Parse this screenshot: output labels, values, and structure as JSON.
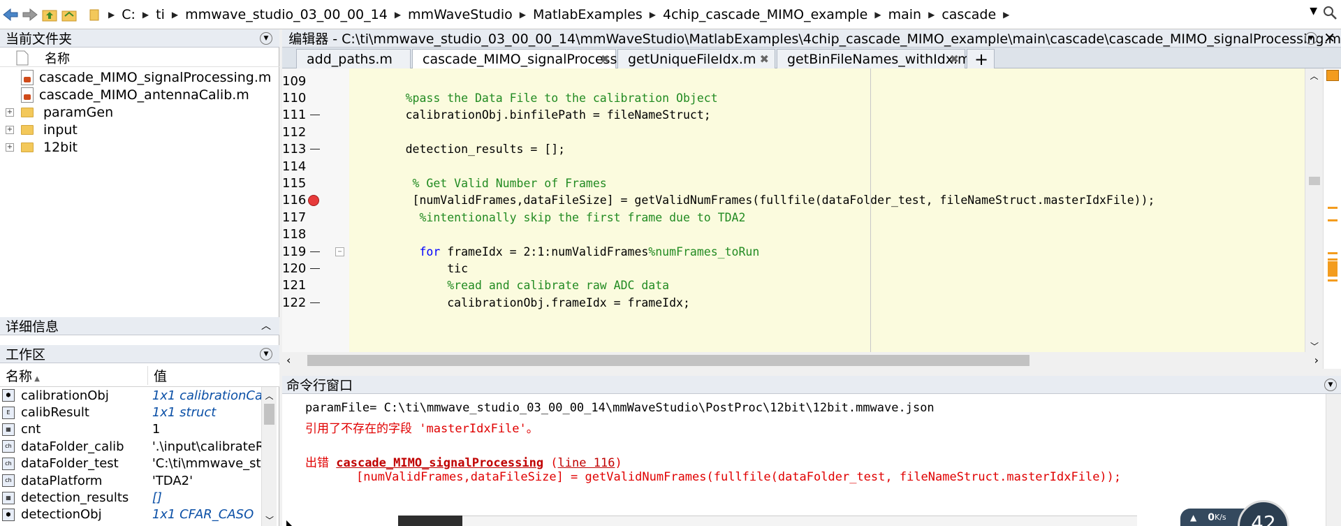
{
  "address_bar": {
    "crumbs": [
      "C:",
      "ti",
      "mmwave_studio_03_00_00_14",
      "mmWaveStudio",
      "MatlabExamples",
      "4chip_cascade_MIMO_example",
      "main",
      "cascade"
    ]
  },
  "current_folder": {
    "title": "当前文件夹",
    "column_name": "名称",
    "items": [
      {
        "name": "cascade_MIMO_signalProcessing.m",
        "type": "mfile"
      },
      {
        "name": "cascade_MIMO_antennaCalib.m",
        "type": "mfile"
      },
      {
        "name": "paramGen",
        "type": "folder"
      },
      {
        "name": "input",
        "type": "folder"
      },
      {
        "name": "12bit",
        "type": "folder"
      }
    ]
  },
  "details": {
    "title": "详细信息"
  },
  "workspace": {
    "title": "工作区",
    "col_name": "名称",
    "col_value": "值",
    "rows": [
      {
        "name": "calibrationObj",
        "value": "1x1 calibrationCa",
        "italic": true,
        "icon": "object-icon"
      },
      {
        "name": "calibResult",
        "value": "1x1 struct",
        "italic": true,
        "icon": "struct-icon"
      },
      {
        "name": "cnt",
        "value": "1",
        "italic": false,
        "icon": "numeric-icon"
      },
      {
        "name": "dataFolder_calib",
        "value": "'.\\input\\calibrateR",
        "italic": false,
        "icon": "char-icon"
      },
      {
        "name": "dataFolder_test",
        "value": "'C:\\ti\\mmwave_stu",
        "italic": false,
        "icon": "char-icon"
      },
      {
        "name": "dataPlatform",
        "value": "'TDA2'",
        "italic": false,
        "icon": "char-icon"
      },
      {
        "name": "detection_results",
        "value": "[]",
        "italic": true,
        "icon": "numeric-icon"
      },
      {
        "name": "detectionObj",
        "value": "1x1 CFAR_CASO",
        "italic": true,
        "icon": "object-icon"
      }
    ]
  },
  "editor": {
    "title": "编辑器 - C:\\ti\\mmwave_studio_03_00_00_14\\mmWaveStudio\\MatlabExamples\\4chip_cascade_MIMO_example\\main\\cascade\\cascade_MIMO_signalProcessing.m",
    "tabs": [
      {
        "label": "add_paths.m",
        "active": false
      },
      {
        "label": "cascade_MIMO_signalProcessing.m",
        "active": true
      },
      {
        "label": "getUniqueFileIdx.m",
        "active": false
      },
      {
        "label": "getBinFileNames_withIdx.m",
        "active": false
      }
    ],
    "add_tab": "+",
    "lines": [
      {
        "n": "109",
        "mark": "",
        "indent": "",
        "parts": []
      },
      {
        "n": "110",
        "mark": "",
        "indent": "      ",
        "parts": [
          {
            "t": "%pass the Data File to the calibration Object",
            "c": "cm"
          }
        ]
      },
      {
        "n": "111",
        "mark": "dash",
        "indent": "      ",
        "parts": [
          {
            "t": "calibrationObj.binfilePath = fileNameStruct;",
            "c": ""
          }
        ]
      },
      {
        "n": "112",
        "mark": "",
        "indent": "",
        "parts": []
      },
      {
        "n": "113",
        "mark": "dash",
        "indent": "      ",
        "parts": [
          {
            "t": "detection_results = [];",
            "c": ""
          }
        ]
      },
      {
        "n": "114",
        "mark": "",
        "indent": "",
        "parts": []
      },
      {
        "n": "115",
        "mark": "",
        "indent": "       ",
        "parts": [
          {
            "t": "% Get Valid Number of Frames",
            "c": "cm"
          }
        ]
      },
      {
        "n": "116",
        "mark": "bp",
        "indent": "       ",
        "parts": [
          {
            "t": "[numValidFrames,dataFileSize] = getValidNumFrames(fullfile(dataFolder_test, fileNameStruct.masterIdxFile));",
            "c": ""
          }
        ]
      },
      {
        "n": "117",
        "mark": "",
        "indent": "        ",
        "parts": [
          {
            "t": "%intentionally skip the first frame due to TDA2",
            "c": "cm"
          }
        ]
      },
      {
        "n": "118",
        "mark": "",
        "indent": "",
        "parts": []
      },
      {
        "n": "119",
        "mark": "dash-fold",
        "indent": "        ",
        "parts": [
          {
            "t": "for",
            "c": "kw"
          },
          {
            "t": " frameIdx = 2:1:numValidFrames",
            "c": ""
          },
          {
            "t": "%numFrames_toRun",
            "c": "cm"
          }
        ]
      },
      {
        "n": "120",
        "mark": "dash",
        "indent": "            ",
        "parts": [
          {
            "t": "tic",
            "c": ""
          }
        ]
      },
      {
        "n": "121",
        "mark": "",
        "indent": "            ",
        "parts": [
          {
            "t": "%read and calibrate raw ADC data",
            "c": "cm"
          }
        ]
      },
      {
        "n": "122",
        "mark": "dash",
        "indent": "            ",
        "parts": [
          {
            "t": "calibrationObj.frameIdx = frameIdx;",
            "c": ""
          }
        ]
      }
    ]
  },
  "command_window": {
    "title": "命令行窗口",
    "line1": "paramFile= C:\\ti\\mmwave_studio_03_00_00_14\\mmWaveStudio\\PostProc\\12bit\\12bit.mmwave.json",
    "line2": "引用了不存在的字段 'masterIdxFile'。",
    "err_prefix": "出错 ",
    "err_func": "cascade_MIMO_signalProcessing",
    "err_line_open": " (",
    "err_line": "line 116",
    "err_line_close": ")",
    "err_code": "[numValidFrames,dataFileSize] = getValidNumFrames(fullfile(dataFolder_test, fileNameStruct.masterIdxFile));"
  },
  "overlay": {
    "net_speed": "0",
    "net_unit": "K/s",
    "circle_value": "42"
  }
}
